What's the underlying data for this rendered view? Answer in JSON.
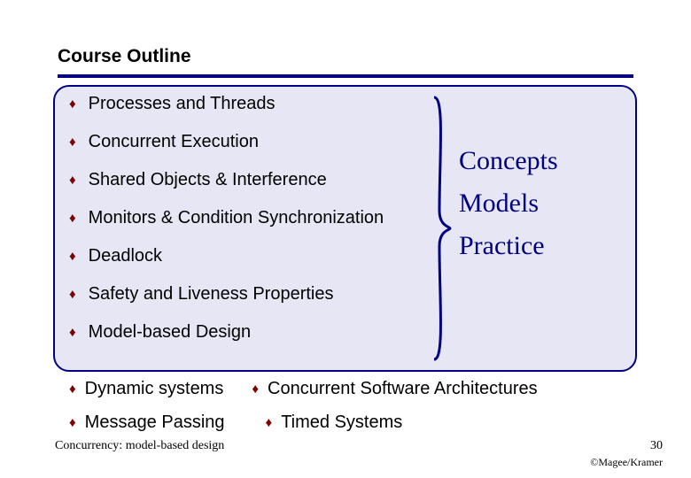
{
  "title": "Course Outline",
  "bullets": [
    "Processes and Threads",
    "Concurrent Execution",
    "Shared Objects & Interference",
    "Monitors & Condition Synchronization",
    "Deadlock",
    "Safety and Liveness Properties",
    "Model-based Design"
  ],
  "categories": {
    "concepts": "Concepts",
    "models": "Models",
    "practice": "Practice"
  },
  "extra": {
    "dynamic": "Dynamic systems",
    "message": "Message Passing",
    "architectures": "Concurrent Software Architectures",
    "timed": "Timed Systems"
  },
  "footer": {
    "left": "Concurrency: model-based design",
    "page": "30",
    "copyright": "©Magee/Kramer"
  },
  "colors": {
    "accent": "#000080",
    "bullet": "#800000",
    "box_bg": "#e6e6f5"
  },
  "glyphs": {
    "diamond": "♦"
  }
}
